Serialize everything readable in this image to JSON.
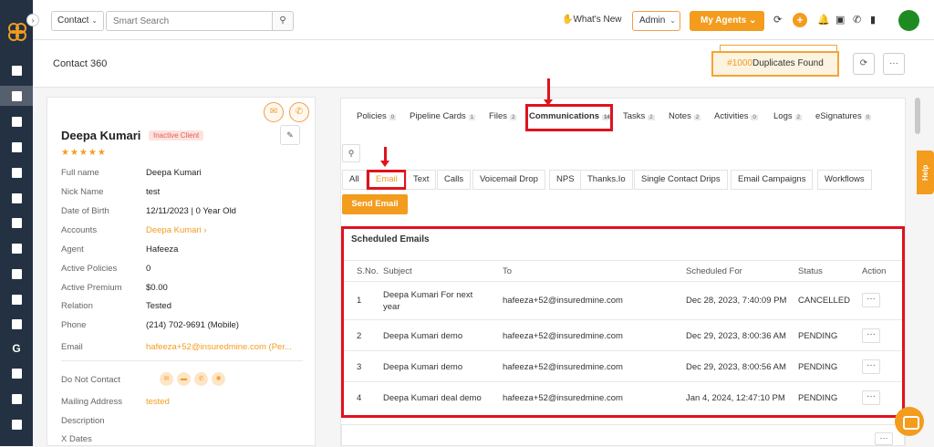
{
  "topbar": {
    "entity_select": "Contact",
    "search_placeholder": "Smart Search",
    "whats_new": "What's New",
    "admin": "Admin",
    "my_agents": "My Agents"
  },
  "subbar": {
    "title": "Contact 360",
    "duplicates_hash": "#1000",
    "duplicates_text": "Duplicates Found"
  },
  "contact": {
    "name": "Deepa Kumari",
    "status_badge": "Inactive Client",
    "stars": "★★★★★",
    "fields": [
      {
        "label": "Full name",
        "value": "Deepa Kumari"
      },
      {
        "label": "Nick Name",
        "value": "test"
      },
      {
        "label": "Date of Birth",
        "value": "12/11/2023 | 0 Year Old"
      },
      {
        "label": "Accounts",
        "value": "Deepa Kumari ›"
      },
      {
        "label": "Agent",
        "value": "Hafeeza"
      },
      {
        "label": "Active Policies",
        "value": "0"
      },
      {
        "label": "Active Premium",
        "value": "$0.00"
      },
      {
        "label": "Relation",
        "value": "Tested"
      },
      {
        "label": "Phone",
        "value": "(214) 702-9691 (Mobile)"
      },
      {
        "label": "Email",
        "value": "hafeeza+52@insuredmine.com (Per..."
      },
      {
        "label": "Do Not Contact",
        "value": ""
      },
      {
        "label": "Mailing Address",
        "value": "tested"
      },
      {
        "label": "Description",
        "value": ""
      },
      {
        "label": "X Dates",
        "value": ""
      }
    ]
  },
  "tabs": [
    {
      "label": "Policies",
      "count": "0"
    },
    {
      "label": "Pipeline Cards",
      "count": "1"
    },
    {
      "label": "Files",
      "count": "2"
    },
    {
      "label": "Communications",
      "count": "14"
    },
    {
      "label": "Tasks",
      "count": "2"
    },
    {
      "label": "Notes",
      "count": "2"
    },
    {
      "label": "Activities",
      "count": "0"
    },
    {
      "label": "Logs",
      "count": "2"
    },
    {
      "label": "eSignatures",
      "count": "0"
    }
  ],
  "subtabs": [
    "All",
    "Email",
    "Text",
    "Calls",
    "Voicemail Drop",
    "NPS",
    "Thanks.Io",
    "Single Contact Drips",
    "Email Campaigns",
    "Workflows"
  ],
  "send_email": "Send Email",
  "scheduled": {
    "title": "Scheduled Emails",
    "columns": [
      "S.No.",
      "Subject",
      "To",
      "Scheduled For",
      "Status",
      "Action"
    ],
    "rows": [
      {
        "sno": "1",
        "subject": "Deepa Kumari For next year",
        "to": "hafeeza+52@insuredmine.com",
        "scheduled": "Dec 28, 2023, 7:40:09 PM",
        "status": "CANCELLED",
        "action": "···"
      },
      {
        "sno": "2",
        "subject": "Deepa Kumari demo",
        "to": "hafeeza+52@insuredmine.com",
        "scheduled": "Dec 29, 2023, 8:00:36 AM",
        "status": "PENDING",
        "action": "···"
      },
      {
        "sno": "3",
        "subject": "Deepa Kumari demo",
        "to": "hafeeza+52@insuredmine.com",
        "scheduled": "Dec 29, 2023, 8:00:56 AM",
        "status": "PENDING",
        "action": "···"
      },
      {
        "sno": "4",
        "subject": "Deepa Kumari deal demo",
        "to": "hafeeza+52@insuredmine.com",
        "scheduled": "Jan 4, 2024, 12:47:10 PM",
        "status": "PENDING",
        "action": "···"
      }
    ]
  },
  "help": "Help",
  "colors": {
    "accent": "#f39c1e",
    "rail": "#233142",
    "highlight": "#e0121c",
    "avatar": "#1e8b22"
  }
}
